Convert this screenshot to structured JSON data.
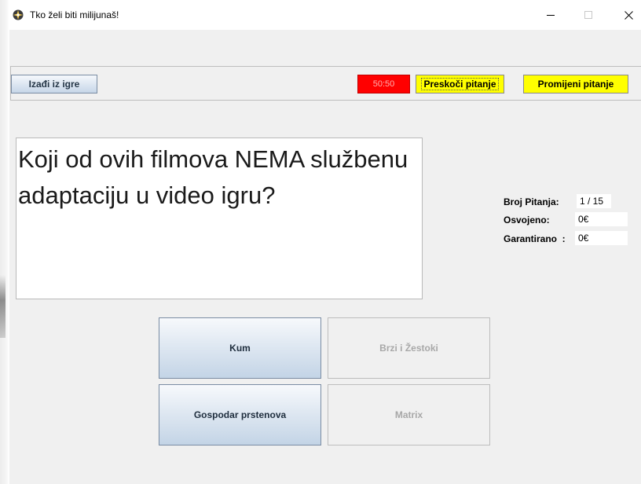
{
  "window": {
    "title": "Tko želi biti milijunaš!"
  },
  "toolbar": {
    "exit_label": "Izađi iz igre",
    "fifty_fifty_label": "50:50",
    "skip_label": "Preskoči pitanje",
    "change_label": "Promijeni pitanje"
  },
  "question": {
    "text": "Koji od ovih filmova NEMA službenu adaptaciju u video igru?"
  },
  "info": {
    "question_count_label": "Broj Pitanja:",
    "question_count_value": "1 / 15",
    "won_label": "Osvojeno:",
    "won_value": "0€",
    "guaranteed_label": "Garantirano  :",
    "guaranteed_value": "0€"
  },
  "answers": [
    {
      "label": "Kum",
      "enabled": true
    },
    {
      "label": "Brzi i Žestoki",
      "enabled": false
    },
    {
      "label": "Gospodar prstenova",
      "enabled": true
    },
    {
      "label": "Matrix",
      "enabled": false
    }
  ],
  "colors": {
    "fifty_fifty_bg": "#ff0000",
    "lifeline_bg": "#ffff00",
    "window_bg": "#f0f0f0"
  }
}
